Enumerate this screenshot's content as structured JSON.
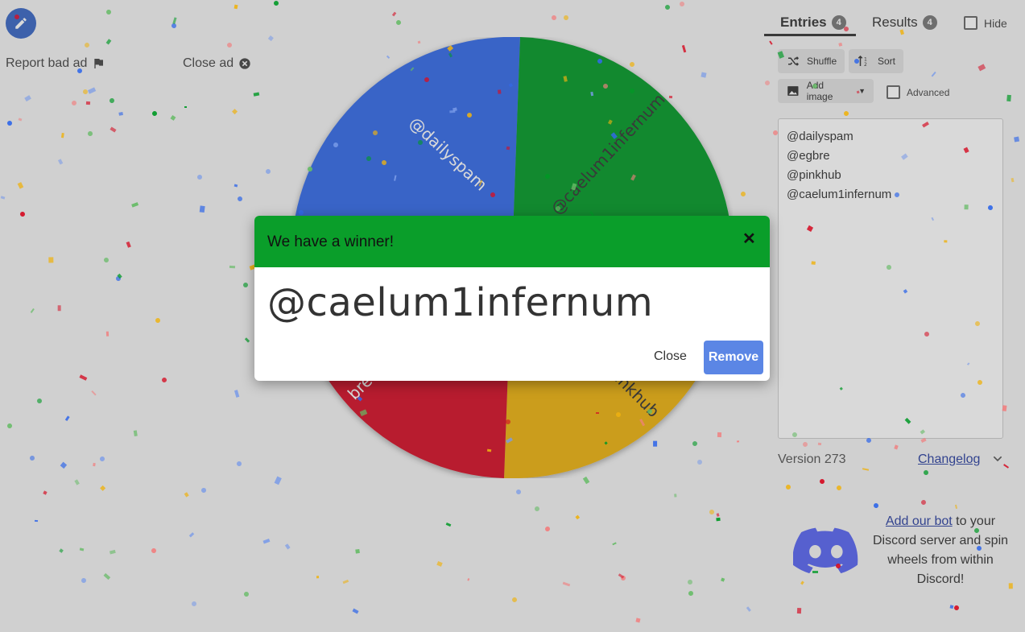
{
  "top_left": {
    "report_ad_label": "Report bad ad",
    "close_ad_label": "Close ad"
  },
  "wheel": {
    "segments": [
      {
        "label": "@dailyspam",
        "color": "#3369e8"
      },
      {
        "label": "@caelum1infernum",
        "color": "#009925"
      },
      {
        "label": "@pinkhub",
        "color": "#eeb211"
      },
      {
        "label": "@egbre",
        "color": "#d50f25"
      }
    ],
    "visible_partial_labels": {
      "pinkhub": "pinkhub",
      "egbre": "bre"
    }
  },
  "tabs": {
    "entries_label": "Entries",
    "entries_count": "4",
    "results_label": "Results",
    "results_count": "4",
    "hide_label": "Hide"
  },
  "toolbar": {
    "shuffle_label": "Shuffle",
    "sort_label": "Sort",
    "add_image_label": "Add image",
    "advanced_label": "Advanced"
  },
  "entries": [
    "@dailyspam",
    "@egbre",
    "@pinkhub",
    "@caelum1infernum"
  ],
  "footer": {
    "version_label": "Version 273",
    "changelog_label": "Changelog",
    "discord_link": "Add our bot",
    "discord_text": " to your Discord server and spin wheels from within Discord!"
  },
  "dialog": {
    "title": "We have a winner!",
    "winner_name": "@caelum1infernum",
    "close_label": "Close",
    "remove_label": "Remove"
  },
  "colors": {
    "accent": "#3866c5",
    "dialog_header": "#0a9e2a",
    "remove_button": "#5b86e5",
    "discord": "#5865f2"
  }
}
